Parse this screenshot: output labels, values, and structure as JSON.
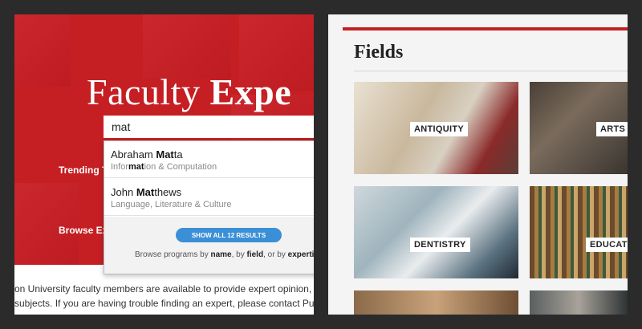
{
  "left_panel": {
    "hero_title_light": "Faculty ",
    "hero_title_bold": "Expe",
    "search": {
      "value": "mat"
    },
    "side_labels": {
      "trending": "Trending T",
      "browse": "Browse Ex"
    },
    "autocomplete": {
      "results": [
        {
          "name_pre": "Abraham ",
          "name_hl": "Mat",
          "name_post": "ta",
          "sub_pre": "Infor",
          "sub_hl": "mat",
          "sub_post": "ion & Computation"
        },
        {
          "name_pre": "John ",
          "name_hl": "Mat",
          "name_post": "thews",
          "sub_pre": "Language, Literature & Culture",
          "sub_hl": "",
          "sub_post": ""
        }
      ],
      "show_all_label": "SHOW ALL 12 RESULTS",
      "browse": {
        "prefix": "Browse programs by ",
        "by_name": "name",
        "sep1": ", by ",
        "by_field": "field",
        "sep2": ", or by ",
        "by_expertise": "expertis"
      }
    },
    "body_line1": "on University faculty members are available to provide expert opinion, comm",
    "body_line2": "subjects. If you are having trouble finding an expert, please contact Publi"
  },
  "right_panel": {
    "title": "Fields",
    "fields": [
      {
        "label": "ANTIQUITY"
      },
      {
        "label": "ARTS"
      },
      {
        "label": "DENTISTRY"
      },
      {
        "label": "EDUCATIO"
      }
    ]
  },
  "colors": {
    "brand_red": "#c51f24",
    "button_blue": "#3b8fd6",
    "background": "#2b2b2b"
  }
}
